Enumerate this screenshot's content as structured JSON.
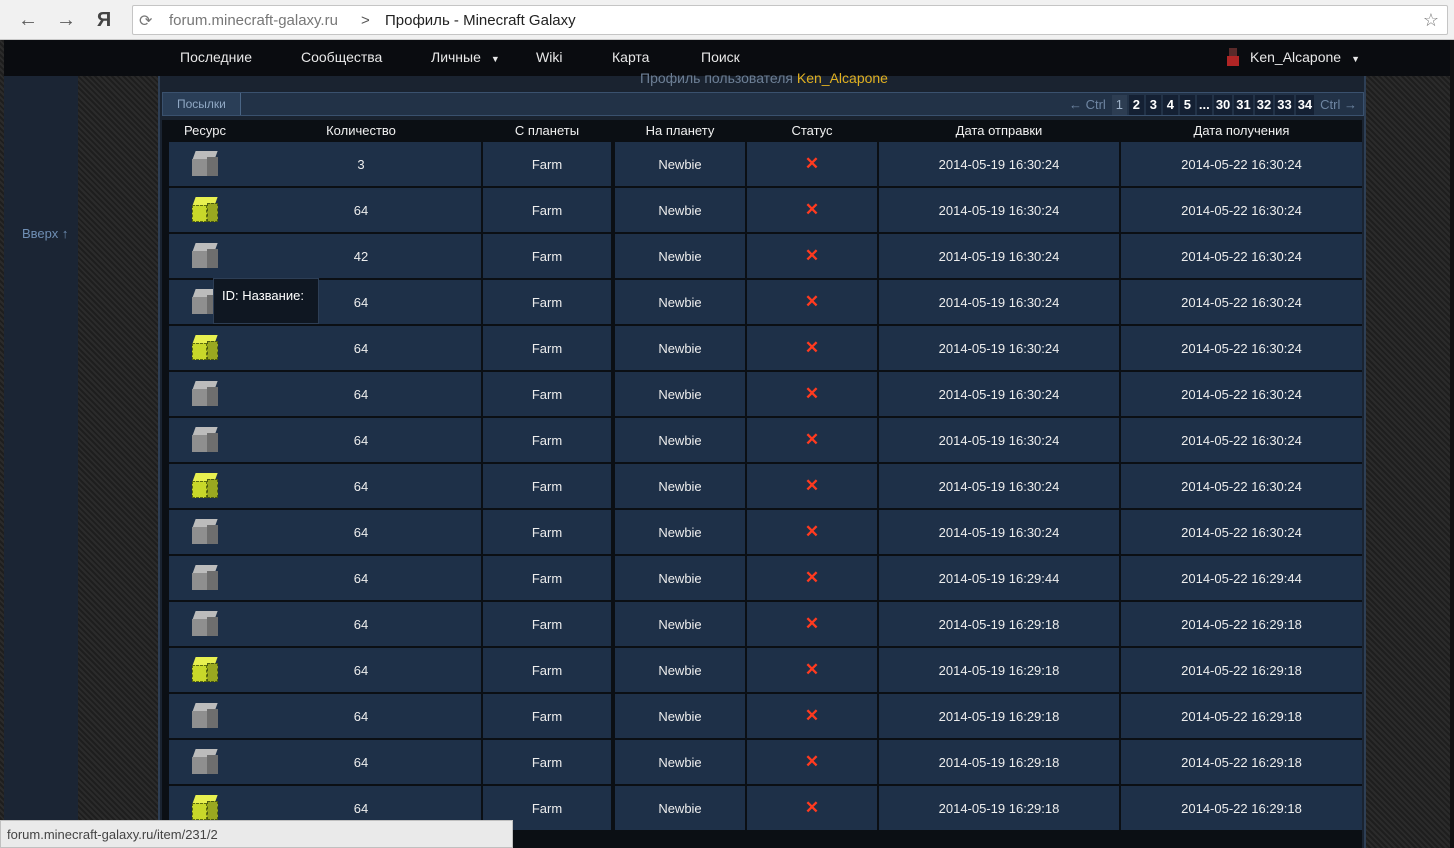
{
  "browser": {
    "host": "forum.minecraft-galaxy.ru",
    "separator": ">",
    "page_title": "Профиль - Minecraft Galaxy",
    "back_icon": "←",
    "forward_icon": "→",
    "yandex_icon": "Я",
    "reload_icon": "⟳",
    "star_icon": "☆"
  },
  "nav": {
    "items": [
      {
        "label": "Последние"
      },
      {
        "label": "Сообщества"
      },
      {
        "label": "Личные"
      },
      {
        "label": "Wiki"
      },
      {
        "label": "Карта"
      },
      {
        "label": "Поиск"
      }
    ],
    "user": "Ken_Alcapone",
    "dropdown": "▼"
  },
  "sidebar": {
    "back_to_top": "Вверх ↑"
  },
  "profile": {
    "title_prefix": "Профиль пользователя",
    "username": "Ken_Alcapone"
  },
  "tabs": {
    "parcels": "Посылки"
  },
  "pager": {
    "prev": "← Ctrl",
    "next": "Ctrl →",
    "pages": [
      "1",
      "2",
      "3",
      "4",
      "5",
      "...",
      "30",
      "31",
      "32",
      "33",
      "34"
    ],
    "current": "1"
  },
  "table": {
    "headers": [
      "Ресурс",
      "Количество",
      "С планеты",
      "На планету",
      "Статус",
      "Дата отправки",
      "Дата получения"
    ],
    "rows": [
      {
        "icon": "stone-block-icon",
        "qty": "3",
        "from": "Farm",
        "to": "Newbie",
        "status": "✕",
        "sent": "2014-05-19 16:30:24",
        "recv": "2014-05-22 16:30:24"
      },
      {
        "icon": "glowstone-block-icon",
        "qty": "64",
        "from": "Farm",
        "to": "Newbie",
        "status": "✕",
        "sent": "2014-05-19 16:30:24",
        "recv": "2014-05-22 16:30:24"
      },
      {
        "icon": "stone-block-icon",
        "qty": "42",
        "from": "Farm",
        "to": "Newbie",
        "status": "✕",
        "sent": "2014-05-19 16:30:24",
        "recv": "2014-05-22 16:30:24"
      },
      {
        "icon": "stone-block-icon",
        "qty": "64",
        "from": "Farm",
        "to": "Newbie",
        "status": "✕",
        "sent": "2014-05-19 16:30:24",
        "recv": "2014-05-22 16:30:24"
      },
      {
        "icon": "glowstone-block-icon",
        "qty": "64",
        "from": "Farm",
        "to": "Newbie",
        "status": "✕",
        "sent": "2014-05-19 16:30:24",
        "recv": "2014-05-22 16:30:24"
      },
      {
        "icon": "stone-block-icon",
        "qty": "64",
        "from": "Farm",
        "to": "Newbie",
        "status": "✕",
        "sent": "2014-05-19 16:30:24",
        "recv": "2014-05-22 16:30:24"
      },
      {
        "icon": "stone-block-icon",
        "qty": "64",
        "from": "Farm",
        "to": "Newbie",
        "status": "✕",
        "sent": "2014-05-19 16:30:24",
        "recv": "2014-05-22 16:30:24"
      },
      {
        "icon": "glowstone-block-icon",
        "qty": "64",
        "from": "Farm",
        "to": "Newbie",
        "status": "✕",
        "sent": "2014-05-19 16:30:24",
        "recv": "2014-05-22 16:30:24"
      },
      {
        "icon": "stone-block-icon",
        "qty": "64",
        "from": "Farm",
        "to": "Newbie",
        "status": "✕",
        "sent": "2014-05-19 16:30:24",
        "recv": "2014-05-22 16:30:24"
      },
      {
        "icon": "stone-block-icon",
        "qty": "64",
        "from": "Farm",
        "to": "Newbie",
        "status": "✕",
        "sent": "2014-05-19 16:29:44",
        "recv": "2014-05-22 16:29:44"
      },
      {
        "icon": "stone-block-icon",
        "qty": "64",
        "from": "Farm",
        "to": "Newbie",
        "status": "✕",
        "sent": "2014-05-19 16:29:18",
        "recv": "2014-05-22 16:29:18"
      },
      {
        "icon": "glowstone-block-icon",
        "qty": "64",
        "from": "Farm",
        "to": "Newbie",
        "status": "✕",
        "sent": "2014-05-19 16:29:18",
        "recv": "2014-05-22 16:29:18"
      },
      {
        "icon": "stone-block-icon",
        "qty": "64",
        "from": "Farm",
        "to": "Newbie",
        "status": "✕",
        "sent": "2014-05-19 16:29:18",
        "recv": "2014-05-22 16:29:18"
      },
      {
        "icon": "stone-block-icon",
        "qty": "64",
        "from": "Farm",
        "to": "Newbie",
        "status": "✕",
        "sent": "2014-05-19 16:29:18",
        "recv": "2014-05-22 16:29:18"
      },
      {
        "icon": "glowstone-block-icon",
        "qty": "64",
        "from": "Farm",
        "to": "Newbie",
        "status": "✕",
        "sent": "2014-05-19 16:29:18",
        "recv": "2014-05-22 16:29:18"
      }
    ]
  },
  "tooltip": {
    "text": "ID: Название:"
  },
  "statusbar": {
    "url": "forum.minecraft-galaxy.ru/item/231/2"
  },
  "colors": {
    "accent_user": "#e0b020",
    "status_fail": "#ff3a1f",
    "cell_bg": "#1e3048"
  }
}
